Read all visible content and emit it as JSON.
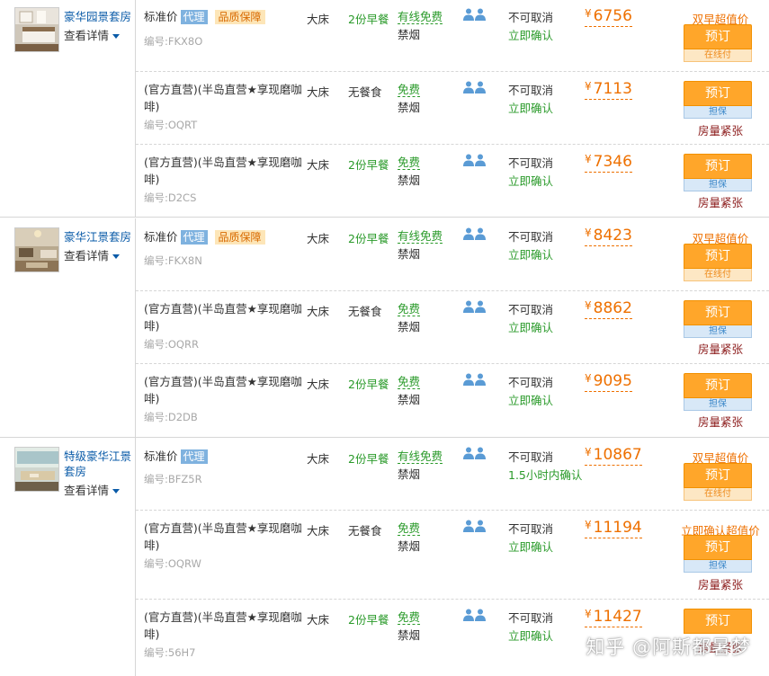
{
  "rooms": [
    {
      "name": "豪华园景套房",
      "details_label": "查看详情",
      "rates": [
        {
          "type": "std",
          "label": "标准价",
          "tag": "代理",
          "quality_badge": "品质保障",
          "code": "编号:FKX8O",
          "bed": "大床",
          "breakfast": "2份早餐",
          "net": "有线免费",
          "smoke": "禁烟",
          "cancel": "不可取消",
          "confirm": "立即确认",
          "currency": "¥",
          "price": "6756",
          "promo": "双早超值价",
          "book": "预订",
          "book_sub": "在线付",
          "sub_kind": "online",
          "scarcity": ""
        },
        {
          "type": "direct",
          "label": "(官方直营)(半岛直营★享现磨咖啡)",
          "tag": "",
          "quality_badge": "",
          "code": "编号:OQRT",
          "bed": "大床",
          "breakfast": "无餐食",
          "net": "免费",
          "smoke": "禁烟",
          "cancel": "不可取消",
          "confirm": "立即确认",
          "currency": "¥",
          "price": "7113",
          "promo": "",
          "book": "预订",
          "book_sub": "担保",
          "sub_kind": "guar",
          "scarcity": "房量紧张"
        },
        {
          "type": "direct",
          "label": "(官方直营)(半岛直营★享现磨咖啡)",
          "tag": "",
          "quality_badge": "",
          "code": "编号:D2CS",
          "bed": "大床",
          "breakfast": "2份早餐",
          "net": "免费",
          "smoke": "禁烟",
          "cancel": "不可取消",
          "confirm": "立即确认",
          "currency": "¥",
          "price": "7346",
          "promo": "",
          "book": "预订",
          "book_sub": "担保",
          "sub_kind": "guar",
          "scarcity": "房量紧张"
        }
      ]
    },
    {
      "name": "豪华江景套房",
      "details_label": "查看详情",
      "rates": [
        {
          "type": "std",
          "label": "标准价",
          "tag": "代理",
          "quality_badge": "品质保障",
          "code": "编号:FKX8N",
          "bed": "大床",
          "breakfast": "2份早餐",
          "net": "有线免费",
          "smoke": "禁烟",
          "cancel": "不可取消",
          "confirm": "立即确认",
          "currency": "¥",
          "price": "8423",
          "promo": "双早超值价",
          "book": "预订",
          "book_sub": "在线付",
          "sub_kind": "online",
          "scarcity": ""
        },
        {
          "type": "direct",
          "label": "(官方直营)(半岛直营★享现磨咖啡)",
          "tag": "",
          "quality_badge": "",
          "code": "编号:OQRR",
          "bed": "大床",
          "breakfast": "无餐食",
          "net": "免费",
          "smoke": "禁烟",
          "cancel": "不可取消",
          "confirm": "立即确认",
          "currency": "¥",
          "price": "8862",
          "promo": "",
          "book": "预订",
          "book_sub": "担保",
          "sub_kind": "guar",
          "scarcity": "房量紧张"
        },
        {
          "type": "direct",
          "label": "(官方直营)(半岛直营★享现磨咖啡)",
          "tag": "",
          "quality_badge": "",
          "code": "编号:D2DB",
          "bed": "大床",
          "breakfast": "2份早餐",
          "net": "免费",
          "smoke": "禁烟",
          "cancel": "不可取消",
          "confirm": "立即确认",
          "currency": "¥",
          "price": "9095",
          "promo": "",
          "book": "预订",
          "book_sub": "担保",
          "sub_kind": "guar",
          "scarcity": "房量紧张"
        }
      ]
    },
    {
      "name": "特级豪华江景套房",
      "details_label": "查看详情",
      "rates": [
        {
          "type": "std",
          "label": "标准价",
          "tag": "代理",
          "quality_badge": "",
          "code": "编号:BFZ5R",
          "bed": "大床",
          "breakfast": "2份早餐",
          "net": "有线免费",
          "smoke": "禁烟",
          "cancel": "不可取消",
          "confirm": "1.5小时内确认",
          "currency": "¥",
          "price": "10867",
          "promo": "双早超值价",
          "book": "预订",
          "book_sub": "在线付",
          "sub_kind": "online",
          "scarcity": ""
        },
        {
          "type": "direct",
          "label": "(官方直营)(半岛直营★享现磨咖啡)",
          "tag": "",
          "quality_badge": "",
          "code": "编号:OQRW",
          "bed": "大床",
          "breakfast": "无餐食",
          "net": "免费",
          "smoke": "禁烟",
          "cancel": "不可取消",
          "confirm": "立即确认",
          "currency": "¥",
          "price": "11194",
          "promo": "立即确认超值价",
          "book": "预订",
          "book_sub": "担保",
          "sub_kind": "guar",
          "scarcity": "房量紧张"
        },
        {
          "type": "direct",
          "label": "(官方直营)(半岛直营★享现磨咖啡)",
          "tag": "",
          "quality_badge": "",
          "code": "编号:56H7",
          "bed": "大床",
          "breakfast": "2份早餐",
          "net": "免费",
          "smoke": "禁烟",
          "cancel": "不可取消",
          "confirm": "立即确认",
          "currency": "¥",
          "price": "11427",
          "promo": "",
          "book": "预订",
          "book_sub": "",
          "sub_kind": "",
          "scarcity": "房量紧张"
        }
      ]
    }
  ],
  "watermark": "知乎 @阿斯都暑梦",
  "colors": {
    "accent_orange": "#ee7000",
    "button_orange": "#ffa62a",
    "link_blue": "#0a5ba8",
    "green": "#2a9a2a",
    "scarcity_red": "#8b1a1a"
  }
}
